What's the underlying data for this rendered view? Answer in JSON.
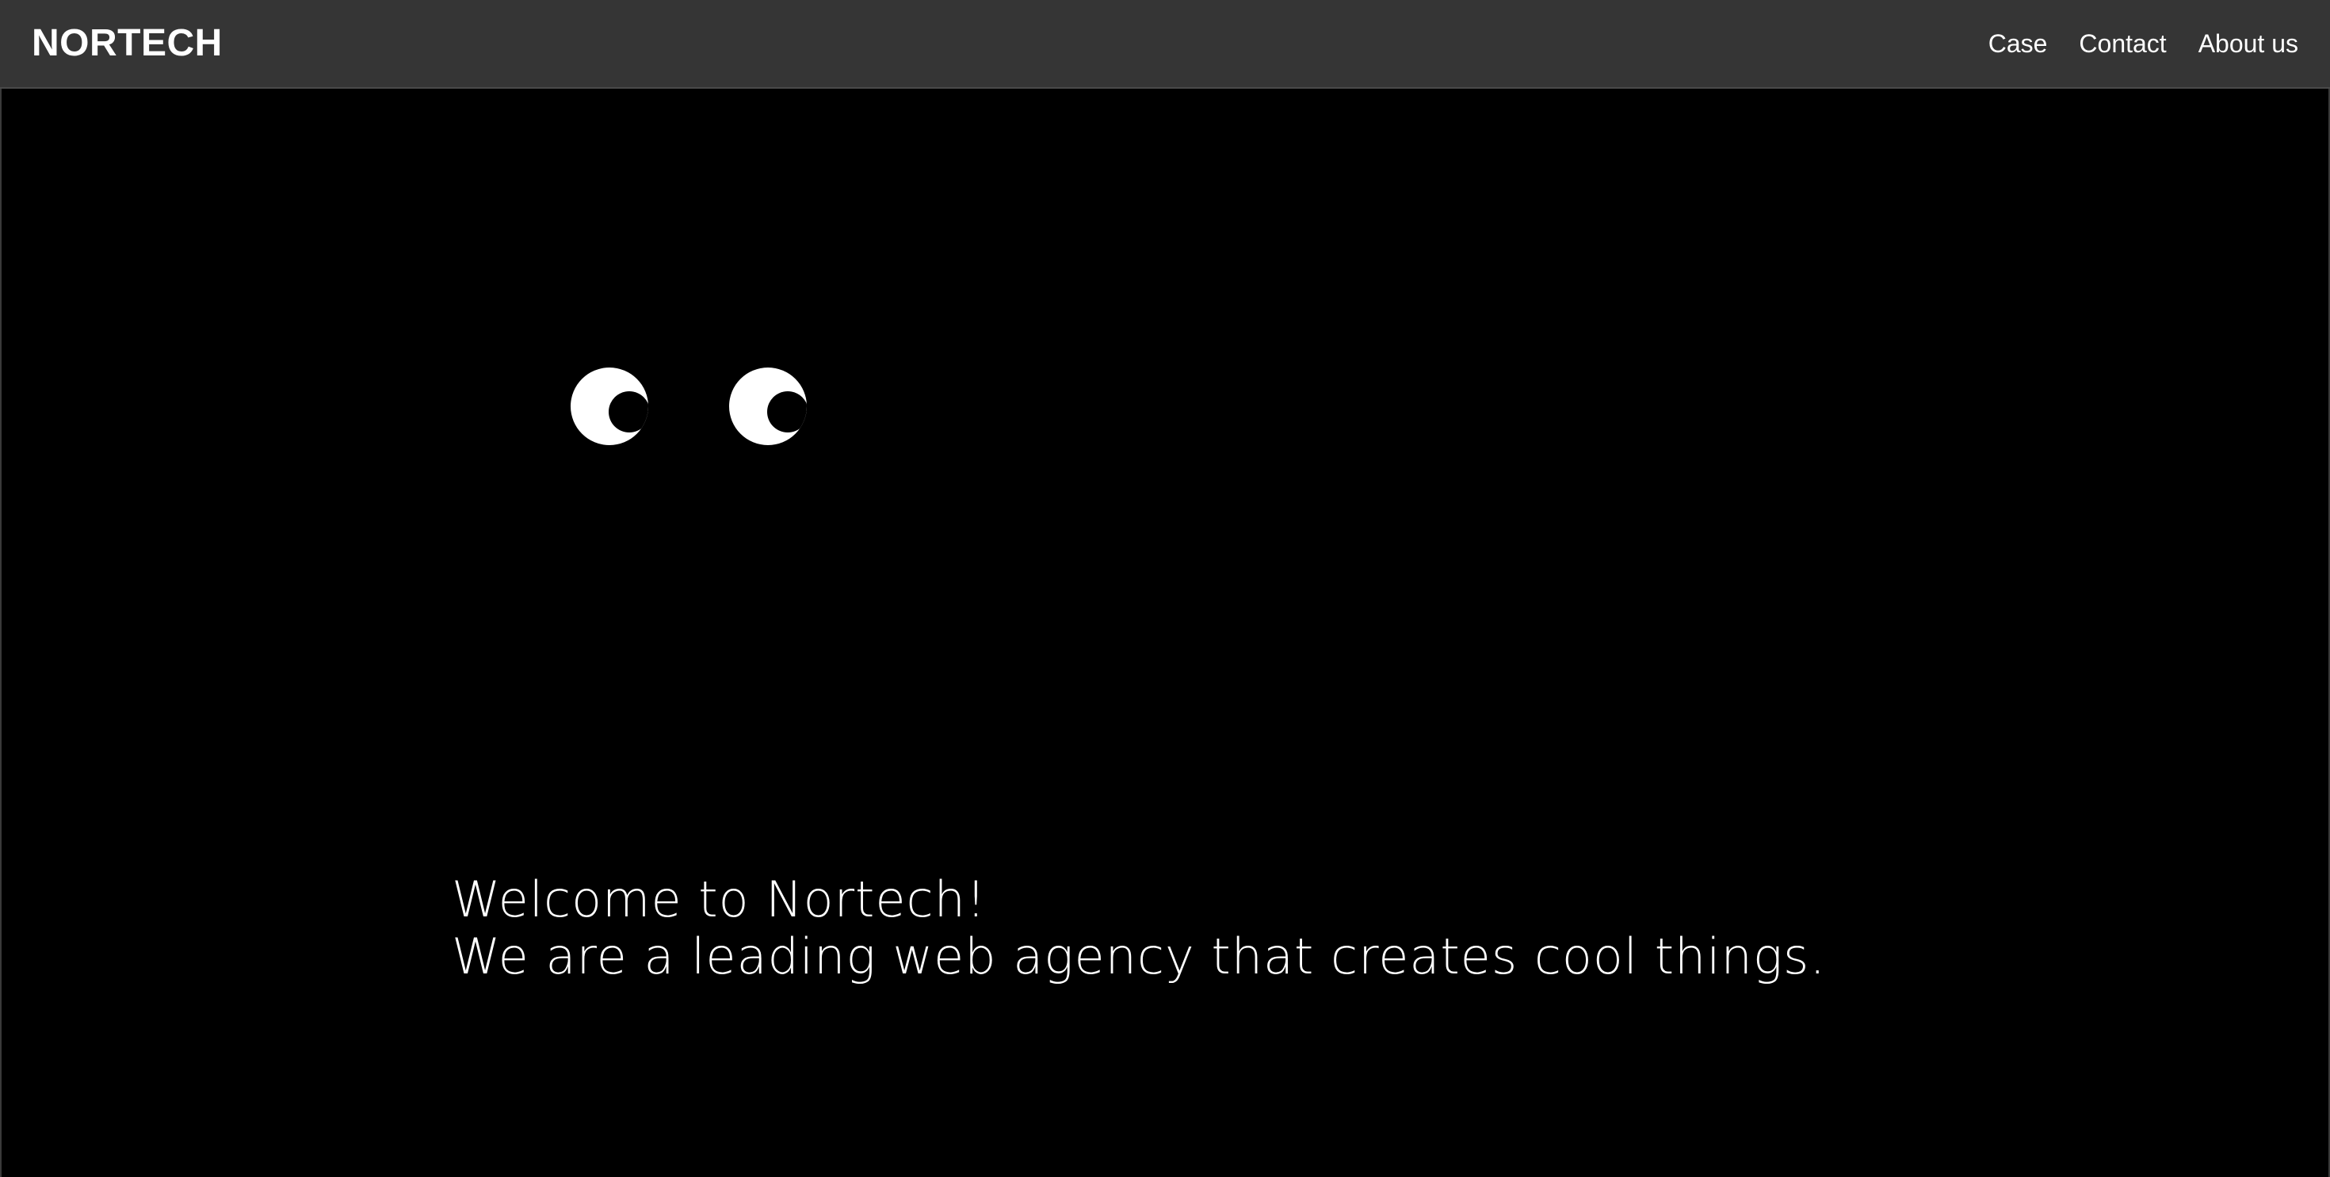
{
  "header": {
    "brand": "NORTECH",
    "nav": [
      {
        "label": "Case"
      },
      {
        "label": "Contact"
      },
      {
        "label": "About us"
      }
    ]
  },
  "hero": {
    "line1": "Welcome to Nortech!",
    "line2": "We are a leading web agency that creates cool things."
  },
  "colors": {
    "background": "#000000",
    "header_background": "#353535",
    "text": "#ffffff",
    "eye_white": "#ffffff",
    "pupil": "#000000"
  }
}
